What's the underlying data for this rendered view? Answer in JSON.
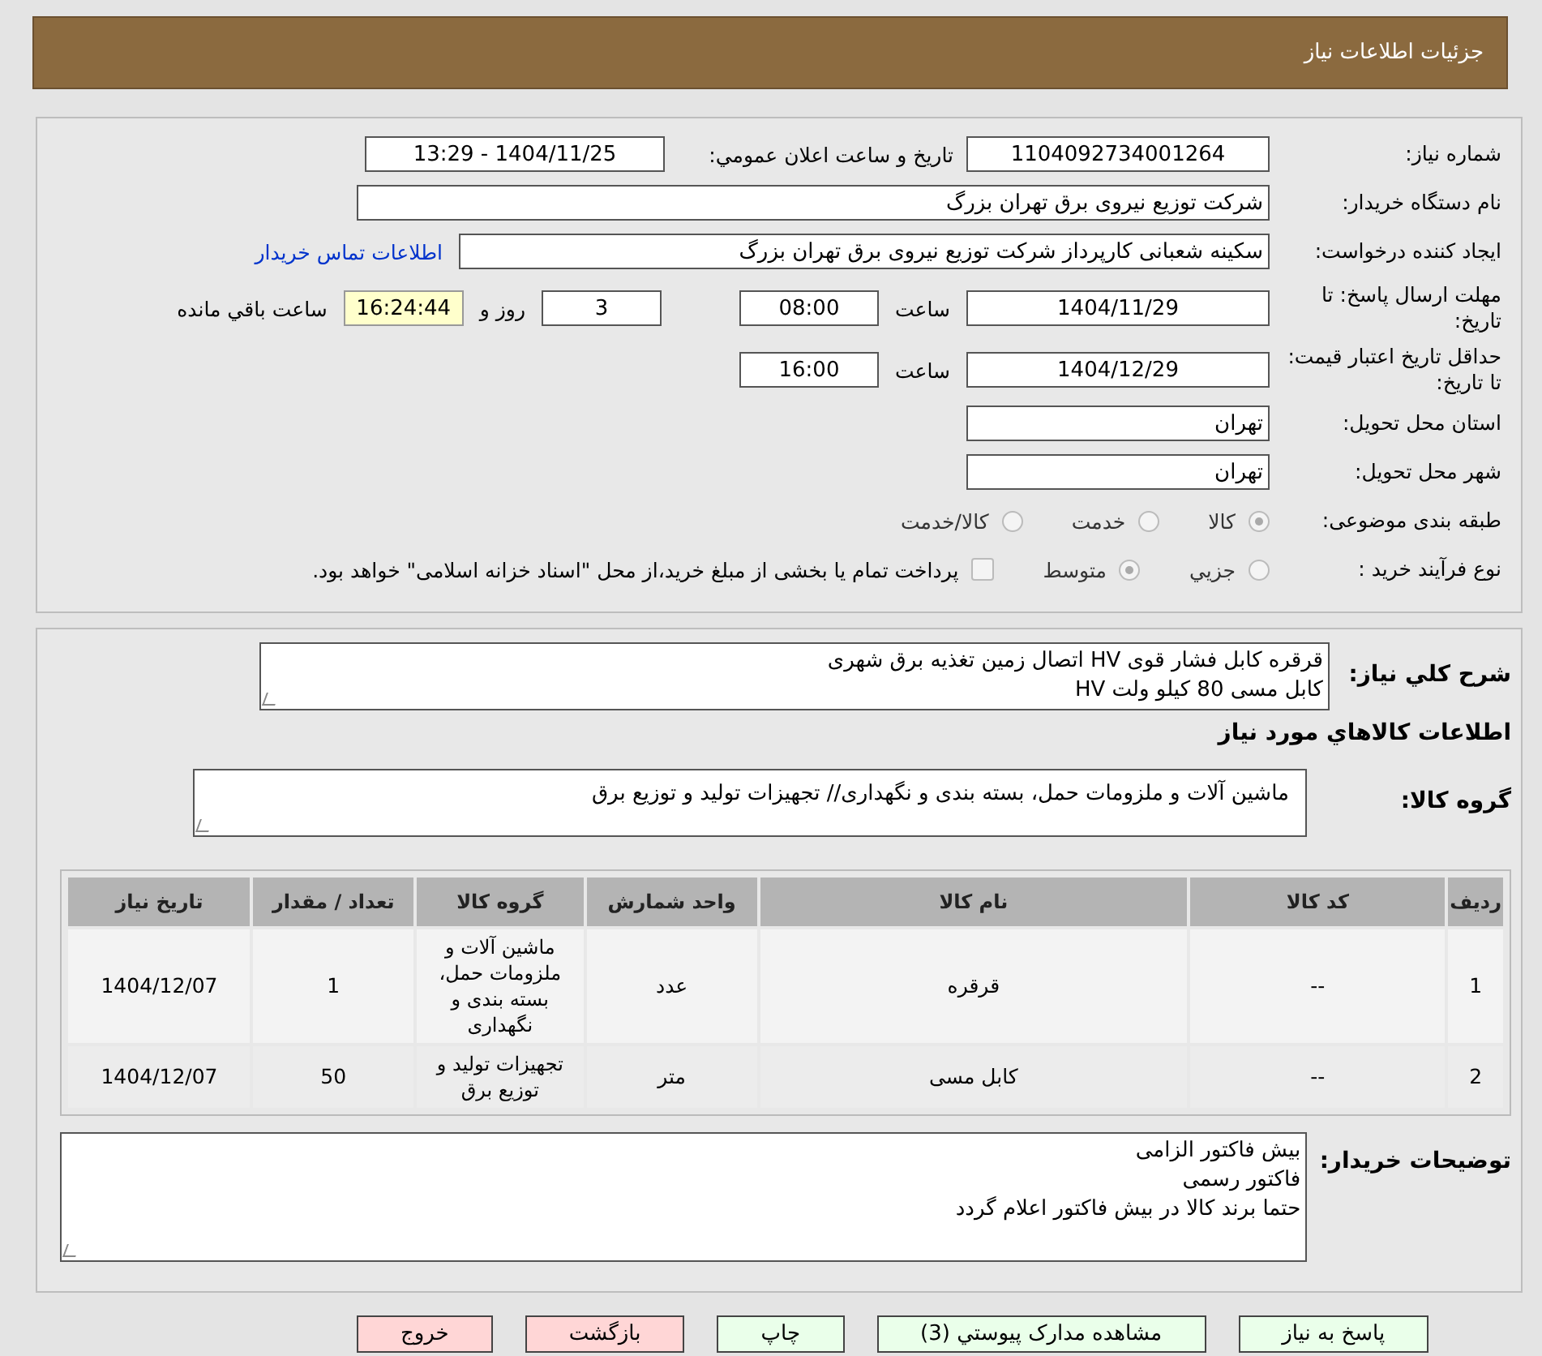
{
  "header": {
    "title": "جزئیات اطلاعات نیاز"
  },
  "need_number": {
    "label": "شماره نیاز:",
    "value": "1104092734001264"
  },
  "announce": {
    "label": "تاريخ و ساعت اعلان عمومي:",
    "value": "1404/11/25 - 13:29"
  },
  "buyer_org": {
    "label": "نام دستگاه خریدار:",
    "value": "شرکت توزیع نیروی برق تهران بزرگ"
  },
  "requester": {
    "label": "ایجاد کننده درخواست:",
    "value": "سکینه شعبانی کارپرداز شرکت توزیع نیروی برق تهران بزرگ",
    "link": "اطلاعات تماس خریدار"
  },
  "deadline": {
    "label": "مهلت ارسال پاسخ: تا تاریخ:",
    "date": "1404/11/29",
    "time_label": "ساعت",
    "time": "08:00",
    "days": "3",
    "days_label": "روز و",
    "remaining": "16:24:44",
    "remaining_label": "ساعت باقي مانده"
  },
  "validity": {
    "label": "حداقل تاریخ اعتبار قیمت: تا تاریخ:",
    "date": "1404/12/29",
    "time_label": "ساعت",
    "time": "16:00"
  },
  "province": {
    "label": "استان محل تحویل:",
    "value": "تهران"
  },
  "city": {
    "label": "شهر محل تحویل:",
    "value": "تهران"
  },
  "category": {
    "label": "طبقه بندی موضوعی:",
    "options": [
      {
        "label": "کالا",
        "selected": true
      },
      {
        "label": "خدمت",
        "selected": false
      },
      {
        "label": "کالا/خدمت",
        "selected": false
      }
    ]
  },
  "process": {
    "label": "نوع فرآیند خرید :",
    "options": [
      {
        "label": "جزیي",
        "selected": false
      },
      {
        "label": "متوسط",
        "selected": true
      }
    ],
    "payment": {
      "label": "پرداخت تمام یا بخشی از مبلغ خرید،از محل \"اسناد خزانه اسلامی\" خواهد بود.",
      "checked": false
    }
  },
  "description": {
    "label": "شرح کلي نیاز:",
    "lines": [
      "قرقره کابل فشار قوی HV اتصال زمین تغذیه برق شهری",
      "کابل مسی 80 کیلو ولت HV"
    ]
  },
  "goods_heading": "اطلاعات کالاهاي مورد نیاز",
  "goods_group": {
    "label": "گروه کالا:",
    "value": "ماشین آلات و ملزومات حمل، بسته بندی و نگهداری// تجهیزات تولید و توزیع برق"
  },
  "table": {
    "columns": [
      "ردیف",
      "کد کالا",
      "نام کالا",
      "واحد شمارش",
      "گروه کالا",
      "تعداد / مقدار",
      "تاریخ نیاز"
    ],
    "rows": [
      [
        "1",
        "--",
        "قرقره",
        "عدد",
        "ماشین آلات و ملزومات حمل، بسته بندی و نگهداری",
        "1",
        "1404/12/07"
      ],
      [
        "2",
        "--",
        "کابل مسی",
        "متر",
        "تجهیزات تولید و توزیع برق",
        "50",
        "1404/12/07"
      ]
    ]
  },
  "buyer_notes": {
    "label": "توضیحات خریدار:",
    "lines": [
      "بیش فاکتور الزامی",
      "فاکتور رسمی",
      "حتما برند کالا در بیش فاکتور اعلام گردد"
    ]
  },
  "buttons": [
    {
      "label": "پاسخ به نیاز",
      "color": "#eaffea"
    },
    {
      "label": "مشاهده مدارک پیوستي (3)",
      "color": "#eaffea"
    },
    {
      "label": "چاپ",
      "color": "#eaffea"
    },
    {
      "label": "بازگشت",
      "color": "#ffd6d6"
    },
    {
      "label": "خروج",
      "color": "#ffd6d6"
    }
  ]
}
